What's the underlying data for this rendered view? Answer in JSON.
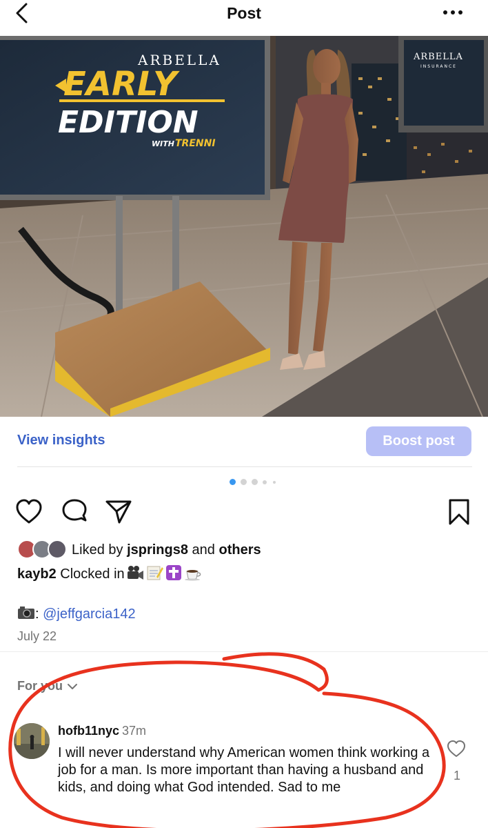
{
  "header": {
    "title": "Post",
    "back_icon": "chevron-left-icon",
    "more_icon": "more-horizontal-icon"
  },
  "photo": {
    "show_brand": "ARBELLA",
    "show_title_line1": "EARLY",
    "show_title_line2": "EDITION",
    "show_with": "WITH",
    "show_host": "TRENNI",
    "sponsor_name": "ARBELLA",
    "sponsor_sub": "INSURANCE"
  },
  "insights": {
    "view_label": "View insights",
    "boost_label": "Boost post",
    "boost_color": "#b7bff6",
    "link_color": "#3b62c8"
  },
  "carousel": {
    "total_dots": 5,
    "active_index": 0,
    "active_color": "#3897f0"
  },
  "actions": {
    "like_icon": "heart-icon",
    "comment_icon": "comment-icon",
    "share_icon": "send-icon",
    "save_icon": "bookmark-icon"
  },
  "likes": {
    "prefix": "Liked by",
    "user": "jsprings8",
    "connector": "and",
    "others": "others"
  },
  "caption": {
    "username": "kayb2",
    "text": "Clocked in",
    "emojis": [
      "movie-camera-emoji",
      "memo-emoji",
      "latin-cross-emoji",
      "coffee-emoji"
    ]
  },
  "credit": {
    "emoji": "camera-emoji",
    "separator": ":",
    "mention": "@jeffgarcia142"
  },
  "post_date": "July 22",
  "comments_filter": "For you",
  "comment": {
    "username": "hofb11nyc",
    "time": "37m",
    "text": "I will never understand why American women think working a job for a man. Is more important than having a husband and kids, and doing what God intended. Sad to me",
    "likes": "1"
  },
  "annotation_color": "#e8321e"
}
